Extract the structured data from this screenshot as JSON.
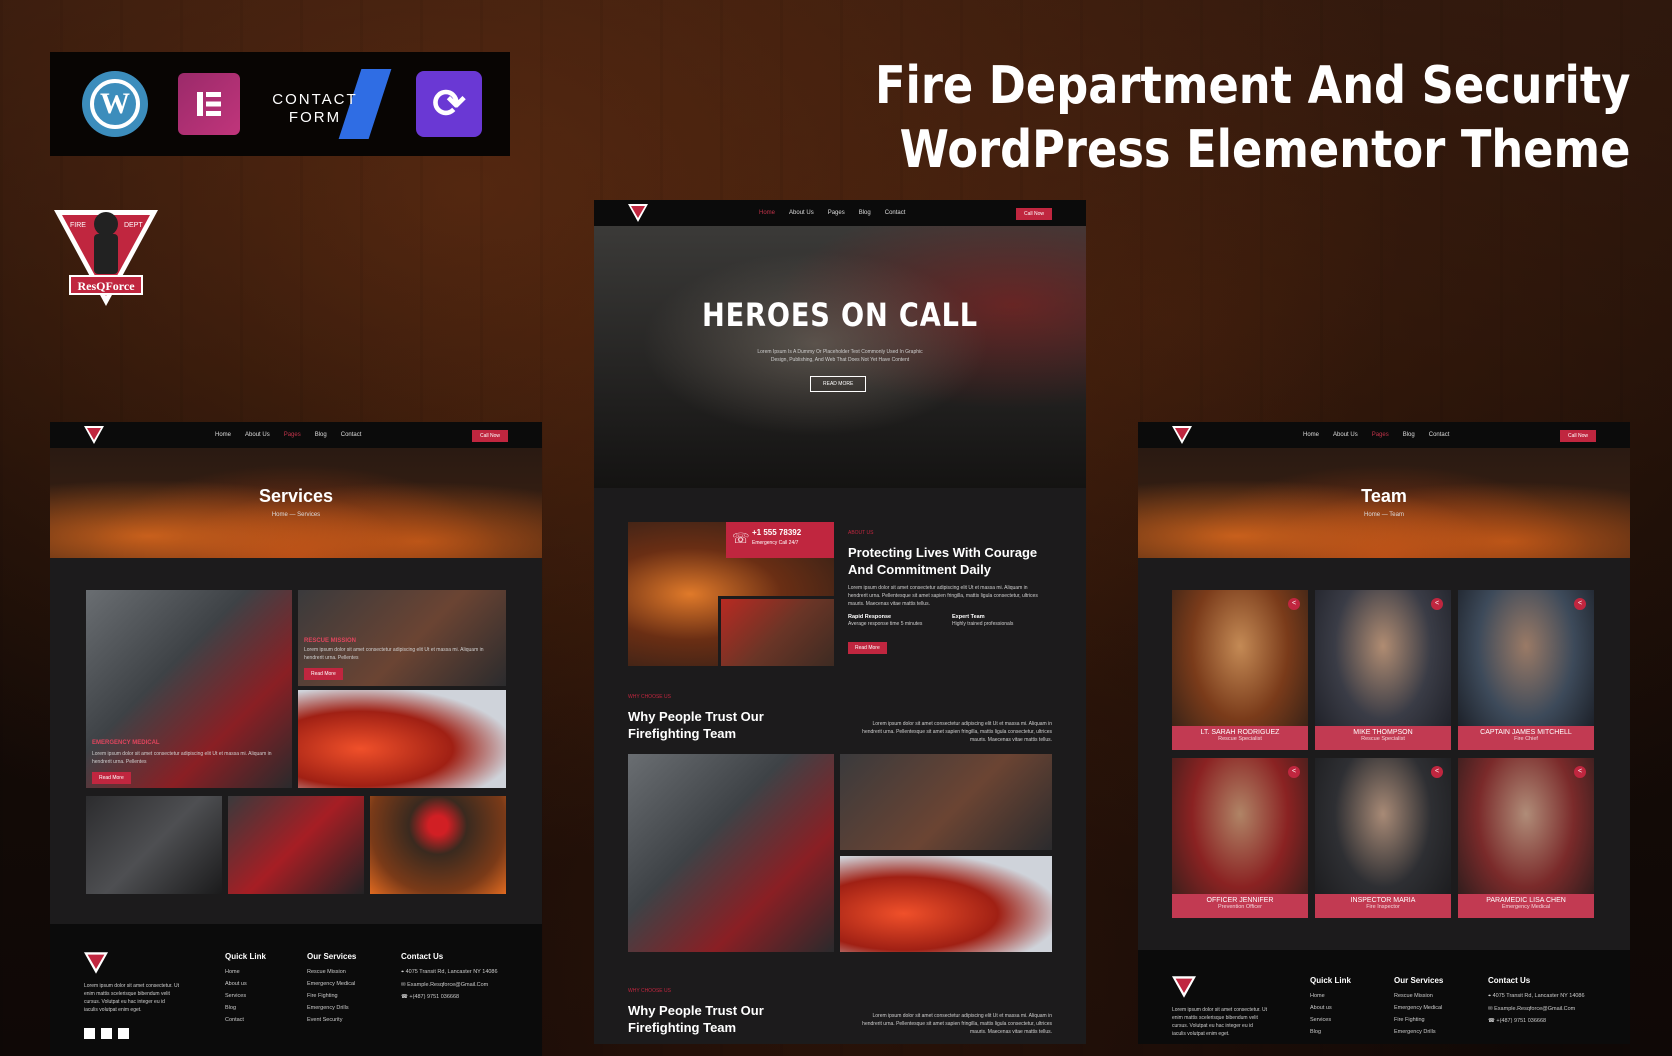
{
  "headline": {
    "line1": "Fire Department And Security",
    "line2": "WordPress Elementor Theme"
  },
  "plugins": {
    "wordpress": "wordpress-icon",
    "elementor": "elementor-icon",
    "contact_form": {
      "line1": "CONTACT",
      "line2": "FORM"
    },
    "updraft": "sync-icon"
  },
  "logo": {
    "top_left": "FIRE",
    "top_right": "DEPT",
    "name": "ResQForce"
  },
  "nav": {
    "home": "Home",
    "about": "About Us",
    "pages": "Pages",
    "blog": "Blog",
    "contact": "Contact",
    "cta": "Call Now"
  },
  "services_page": {
    "title": "Services",
    "breadcrumb": "Home — Services",
    "cards": [
      {
        "title": "EMERGENCY MEDICAL",
        "text": "Lorem ipsum dolor sit amet consectetur adipiscing elit Ut et massa mi. Aliquam in hendrerit urna. Pellentes",
        "button": "Read More"
      },
      {
        "title": "RESCUE MISSION",
        "text": "Lorem ipsum dolor sit amet consectetur adipiscing elit Ut et massa mi. Aliquam in hendrerit urna. Pellentes",
        "button": "Read More"
      }
    ]
  },
  "home_page": {
    "hero_title": "HEROES ON CALL",
    "hero_text": "Lorem Ipsum Is A Dummy Or Placeholder Text Commonly Used In Graphic Design, Publishing, And Web That Does Not Yet Have Content",
    "hero_button": "READ MORE",
    "phone": "+1 555 78392",
    "phone_sub": "Emergency Call 24/7",
    "about_kicker": "ABOUT US",
    "about_title_1": "Protecting Lives With Courage",
    "about_title_2": "And Commitment Daily",
    "about_text": "Lorem ipsum dolor sit amet consectetur adipiscing elit Ut et massa mi. Aliquam in hendrerit urna. Pellentesque sit amet sapien fringilla, mattis ligula consectetur, ultrices mauris. Maecenas vitae mattis tellus.",
    "feature1_title": "Rapid Response",
    "feature1_sub": "Average response time 5 minutes",
    "feature2_title": "Expert Team",
    "feature2_sub": "Highly trained professionals",
    "about_button": "Read More",
    "why_kicker": "WHY CHOOSE US",
    "why_title_1": "Why People Trust Our",
    "why_title_2": "Firefighting Team",
    "why_text": "Lorem ipsum dolor sit amet consectetur adipiscing elit Ut et massa mi. Aliquam in hendrerit urna. Pellentesque sit amet sapien fringilla, mattis ligula consectetur, ultrices mauris. Maecenas vitae mattis tellus."
  },
  "team_page": {
    "title": "Team",
    "breadcrumb": "Home — Team",
    "members": [
      {
        "name": "LT. SARAH RODRIGUEZ",
        "role": "Rescue Specialist"
      },
      {
        "name": "MIKE THOMPSON",
        "role": "Rescue Specialist"
      },
      {
        "name": "CAPTAIN JAMES MITCHELL",
        "role": "Fire Chief"
      },
      {
        "name": "OFFICER JENNIFER",
        "role": "Prevention Officer"
      },
      {
        "name": "INSPECTOR MARIA",
        "role": "Fire Inspector"
      },
      {
        "name": "PARAMEDIC LISA CHEN",
        "role": "Emergency Medical"
      }
    ]
  },
  "footer": {
    "about": "Lorem ipsum dolor sit amet consectetur. Ut enim mattis scelerisque bibendum velit cursus. Volutpat eu hac integer eu id iaculis volutpat enim eget.",
    "quick_title": "Quick Link",
    "quick": [
      "Home",
      "About us",
      "Services",
      "Blog",
      "Contact"
    ],
    "services_title": "Our Services",
    "services": [
      "Rescue Mission",
      "Emergency Medical",
      "Fire Fighting",
      "Emergency Drills",
      "Event Security"
    ],
    "contact_title": "Contact Us",
    "address": "4075 Transit Rd, Lancaster NY 14086",
    "email": "Example.Resqforce@Gmail.Com",
    "phone": "+(487) 9751 036668"
  },
  "colors": {
    "accent": "#c0263f",
    "dark": "#1c1b1c",
    "navbar": "#0b0b0b"
  }
}
